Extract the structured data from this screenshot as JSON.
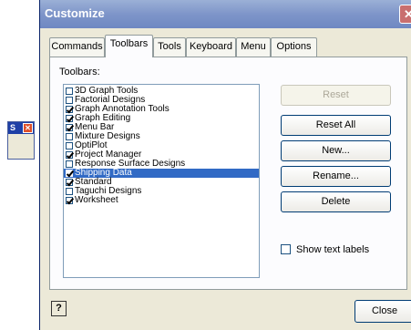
{
  "mini_toolbar": {
    "title": "S",
    "close_glyph": "✕"
  },
  "dialog": {
    "title": "Customize",
    "close_glyph": "✕",
    "tabs": [
      {
        "label": "Commands"
      },
      {
        "label": "Toolbars"
      },
      {
        "label": "Tools"
      },
      {
        "label": "Keyboard"
      },
      {
        "label": "Menu"
      },
      {
        "label": "Options"
      }
    ],
    "toolbars_label": "Toolbars:",
    "toolbars": [
      {
        "label": "3D Graph Tools",
        "checked": false,
        "selected": false
      },
      {
        "label": "Factorial Designs",
        "checked": false,
        "selected": false
      },
      {
        "label": "Graph Annotation Tools",
        "checked": true,
        "selected": false
      },
      {
        "label": "Graph Editing",
        "checked": true,
        "selected": false
      },
      {
        "label": "Menu Bar",
        "checked": true,
        "selected": false
      },
      {
        "label": "Mixture Designs",
        "checked": false,
        "selected": false
      },
      {
        "label": "OptiPlot",
        "checked": false,
        "selected": false
      },
      {
        "label": "Project Manager",
        "checked": true,
        "selected": false
      },
      {
        "label": "Response Surface Designs",
        "checked": false,
        "selected": false
      },
      {
        "label": "Shipping Data",
        "checked": true,
        "selected": true
      },
      {
        "label": "Standard",
        "checked": true,
        "selected": false
      },
      {
        "label": "Taguchi Designs",
        "checked": false,
        "selected": false
      },
      {
        "label": "Worksheet",
        "checked": true,
        "selected": false
      }
    ],
    "buttons": {
      "reset": "Reset",
      "reset_all": "Reset All",
      "new": "New...",
      "rename": "Rename...",
      "delete": "Delete"
    },
    "show_text_labels": {
      "label": "Show text labels",
      "checked": false
    },
    "help_glyph": "?",
    "close_label": "Close"
  },
  "colors": {
    "selection": "#316ac5",
    "title_bar": "#7e95c9",
    "dialog_bg": "#ece9d8"
  }
}
